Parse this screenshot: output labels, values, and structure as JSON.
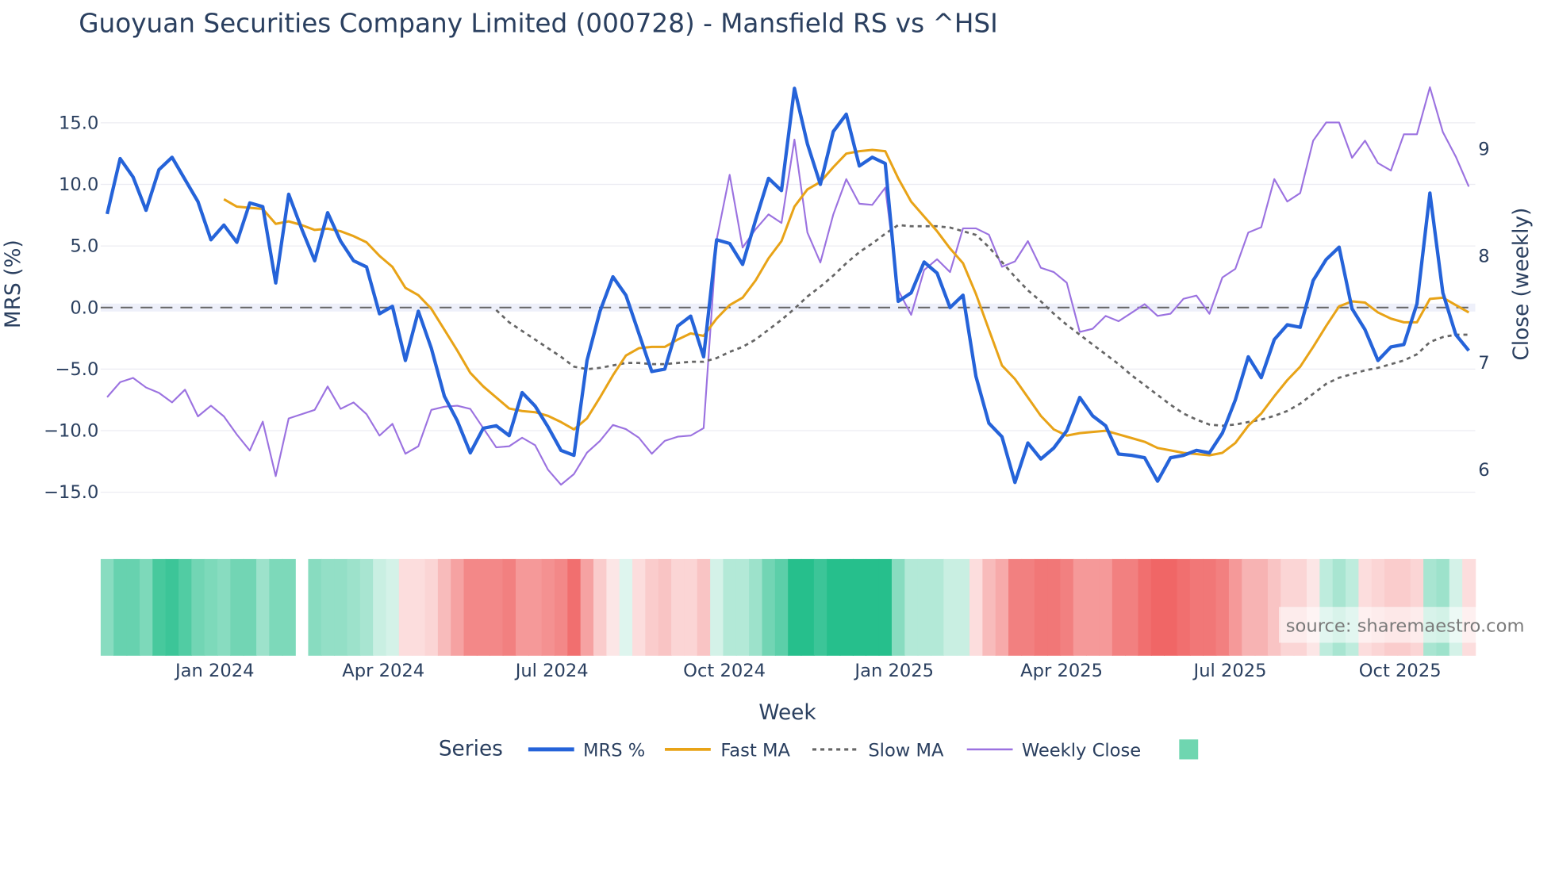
{
  "chart_data": {
    "type": "line",
    "title": "Guoyuan Securities Company Limited (000728) - Mansfield RS vs ^HSI",
    "xlabel": "Week",
    "ylabel": "MRS (%)",
    "y2label": "Close (weekly)",
    "ylim": [
      -16.3,
      18.5
    ],
    "y2lim": [
      5.63,
      9.64
    ],
    "yticks": [
      15,
      10,
      5,
      0,
      -5,
      -10,
      -15
    ],
    "ytick_labels": [
      "15.0",
      "10.0",
      "5.0",
      "0.0",
      "−5.0",
      "−10.0",
      "−15.0"
    ],
    "y2ticks": [
      9,
      8,
      7,
      6
    ],
    "y2tick_labels": [
      "9",
      "8",
      "7",
      "6"
    ],
    "xticks": [
      {
        "label": "Jan 2024",
        "week": 8.3
      },
      {
        "label": "Apr 2024",
        "week": 21.3
      },
      {
        "label": "Jul 2024",
        "week": 34.3
      },
      {
        "label": "Oct 2024",
        "week": 47.6
      },
      {
        "label": "Jan 2025",
        "week": 60.7
      },
      {
        "label": "Apr 2025",
        "week": 73.6
      },
      {
        "label": "Jul 2025",
        "week": 86.6
      },
      {
        "label": "Oct 2025",
        "week": 99.7
      }
    ],
    "grid": true,
    "legend_title": "Series",
    "legend_position": "bottom-center",
    "series": [
      {
        "name": "MRS %",
        "axis": "left",
        "color": "#2563d9",
        "style": "solid",
        "values": [
          7.6,
          12.1,
          10.6,
          7.9,
          11.2,
          12.2,
          10.4,
          8.6,
          5.5,
          6.7,
          5.3,
          8.5,
          8.2,
          2.0,
          9.2,
          6.4,
          3.8,
          7.7,
          5.4,
          3.8,
          3.3,
          -0.5,
          0.1,
          -4.3,
          -0.3,
          -3.3,
          -7.2,
          -9.2,
          -11.8,
          -9.8,
          -9.6,
          -10.4,
          -6.9,
          -8.0,
          -9.7,
          -11.6,
          -12.0,
          -4.3,
          -0.3,
          2.5,
          1.0,
          -2.1,
          -5.2,
          -5.0,
          -1.5,
          -0.7,
          -4.0,
          5.5,
          5.2,
          3.5,
          7.1,
          10.5,
          9.5,
          17.8,
          13.3,
          10.0,
          14.3,
          15.7,
          11.5,
          12.2,
          11.7,
          0.5,
          1.2,
          3.7,
          2.8,
          0.0,
          1.0,
          -5.6,
          -9.4,
          -10.5,
          -14.2,
          -11.0,
          -12.3,
          -11.4,
          -10.0,
          -7.3,
          -8.8,
          -9.6,
          -11.9,
          -12.0,
          -12.2,
          -14.1,
          -12.2,
          -12.0,
          -11.6,
          -11.8,
          -10.2,
          -7.5,
          -4.0,
          -5.7,
          -2.6,
          -1.4,
          -1.6,
          2.2,
          3.9,
          4.9,
          -0.1,
          -1.8,
          -4.3,
          -3.2,
          -3.0,
          0.3,
          9.3,
          1.2,
          -2.2,
          -3.5
        ]
      },
      {
        "name": "Fast MA",
        "axis": "left",
        "color": "#e8a317",
        "style": "solid",
        "values": [
          null,
          null,
          null,
          null,
          null,
          null,
          null,
          null,
          null,
          8.8,
          8.2,
          8.1,
          8.0,
          6.8,
          7.0,
          6.7,
          6.3,
          6.4,
          6.2,
          5.8,
          5.3,
          4.2,
          3.3,
          1.6,
          1.0,
          -0.1,
          -1.8,
          -3.5,
          -5.3,
          -6.4,
          -7.3,
          -8.2,
          -8.4,
          -8.5,
          -8.8,
          -9.3,
          -9.9,
          -9.0,
          -7.3,
          -5.5,
          -3.9,
          -3.3,
          -3.2,
          -3.2,
          -2.6,
          -2.1,
          -2.3,
          -0.9,
          0.2,
          0.8,
          2.2,
          4.0,
          5.4,
          8.2,
          9.6,
          10.2,
          11.4,
          12.5,
          12.7,
          12.8,
          12.7,
          10.5,
          8.6,
          7.4,
          6.2,
          4.8,
          3.6,
          1.1,
          -1.8,
          -4.7,
          -5.8,
          -7.3,
          -8.8,
          -9.9,
          -10.4,
          -10.2,
          -10.1,
          -10.0,
          -10.3,
          -10.6,
          -10.9,
          -11.4,
          -11.6,
          -11.8,
          -11.9,
          -12.0,
          -11.8,
          -11.0,
          -9.6,
          -8.6,
          -7.2,
          -5.9,
          -4.8,
          -3.2,
          -1.5,
          0.1,
          0.5,
          0.4,
          -0.4,
          -0.9,
          -1.2,
          -1.2,
          0.7,
          0.8,
          0.2,
          -0.4
        ]
      },
      {
        "name": "Slow MA",
        "axis": "left",
        "color": "#666666",
        "style": "dot",
        "values": [
          null,
          null,
          null,
          null,
          null,
          null,
          null,
          null,
          null,
          null,
          null,
          null,
          null,
          null,
          null,
          null,
          null,
          null,
          null,
          null,
          null,
          null,
          null,
          null,
          null,
          null,
          null,
          null,
          null,
          null,
          -0.2,
          -1.2,
          -1.9,
          -2.6,
          -3.3,
          -4.0,
          -4.8,
          -5.0,
          -4.9,
          -4.7,
          -4.5,
          -4.5,
          -4.6,
          -4.6,
          -4.5,
          -4.4,
          -4.4,
          -4.1,
          -3.6,
          -3.2,
          -2.6,
          -1.8,
          -1.0,
          -0.1,
          0.9,
          1.7,
          2.6,
          3.6,
          4.5,
          5.2,
          6.0,
          6.7,
          6.6,
          6.6,
          6.6,
          6.5,
          6.2,
          5.9,
          4.9,
          3.7,
          2.5,
          1.4,
          0.5,
          -0.5,
          -1.4,
          -2.2,
          -3.0,
          -3.8,
          -4.6,
          -5.5,
          -6.3,
          -7.1,
          -7.9,
          -8.6,
          -9.1,
          -9.5,
          -9.6,
          -9.5,
          -9.3,
          -9.1,
          -8.8,
          -8.4,
          -7.8,
          -7.0,
          -6.2,
          -5.7,
          -5.4,
          -5.1,
          -4.9,
          -4.6,
          -4.3,
          -3.8,
          -2.8,
          -2.4,
          -2.2,
          -2.2
        ]
      },
      {
        "name": "Weekly Close",
        "axis": "right",
        "color": "#9b72e0",
        "style": "solid",
        "values": [
          6.67,
          6.81,
          6.85,
          6.76,
          6.71,
          6.62,
          6.74,
          6.49,
          6.59,
          6.49,
          6.32,
          6.17,
          6.44,
          5.93,
          6.47,
          6.51,
          6.55,
          6.77,
          6.56,
          6.62,
          6.51,
          6.31,
          6.42,
          6.14,
          6.21,
          6.55,
          6.58,
          6.59,
          6.56,
          6.38,
          6.2,
          6.21,
          6.29,
          6.22,
          5.99,
          5.85,
          5.95,
          6.15,
          6.26,
          6.41,
          6.37,
          6.29,
          6.14,
          6.26,
          6.3,
          6.31,
          6.38,
          8.14,
          8.75,
          8.07,
          8.24,
          8.38,
          8.3,
          9.08,
          8.21,
          7.93,
          8.38,
          8.71,
          8.48,
          8.47,
          8.63,
          7.67,
          7.44,
          7.86,
          7.96,
          7.84,
          8.25,
          8.25,
          8.19,
          7.89,
          7.94,
          8.13,
          7.88,
          7.84,
          7.74,
          7.28,
          7.31,
          7.43,
          7.38,
          7.46,
          7.54,
          7.43,
          7.45,
          7.59,
          7.62,
          7.45,
          7.79,
          7.87,
          8.21,
          8.26,
          8.71,
          8.5,
          8.58,
          9.07,
          9.24,
          9.24,
          8.91,
          9.07,
          8.86,
          8.79,
          9.13,
          9.13,
          9.57,
          9.15,
          8.92,
          8.64
        ]
      }
    ],
    "heatmap": {
      "positive_color": "#26bf8c",
      "negative_color": "#ee5555",
      "values": [
        0.55,
        0.7,
        0.7,
        0.6,
        0.85,
        0.9,
        0.8,
        0.65,
        0.6,
        0.55,
        0.65,
        0.65,
        0.45,
        0.6,
        0.6,
        null,
        0.55,
        0.5,
        0.5,
        0.45,
        0.4,
        0.25,
        0.2,
        -0.2,
        -0.2,
        -0.25,
        -0.4,
        -0.55,
        -0.7,
        -0.7,
        -0.7,
        -0.75,
        -0.6,
        -0.6,
        -0.65,
        -0.7,
        -0.85,
        -0.55,
        -0.3,
        -0.15,
        0.15,
        -0.2,
        -0.3,
        -0.35,
        -0.25,
        -0.25,
        -0.35,
        0.2,
        0.35,
        0.35,
        0.45,
        0.65,
        0.75,
        1.0,
        1.0,
        0.9,
        1.0,
        1.0,
        1.0,
        1.0,
        1.0,
        0.55,
        0.35,
        0.35,
        0.35,
        0.25,
        0.25,
        -0.2,
        -0.4,
        -0.5,
        -0.75,
        -0.75,
        -0.8,
        -0.8,
        -0.75,
        -0.6,
        -0.6,
        -0.6,
        -0.75,
        -0.75,
        -0.85,
        -0.9,
        -0.9,
        -0.85,
        -0.8,
        -0.8,
        -0.75,
        -0.6,
        -0.45,
        -0.45,
        -0.35,
        -0.25,
        -0.25,
        -0.15,
        0.3,
        0.4,
        0.3,
        -0.2,
        -0.25,
        -0.3,
        -0.3,
        -0.25,
        0.4,
        0.45,
        0.2,
        -0.2
      ]
    },
    "source_note": "source: sharemaestro.com"
  }
}
